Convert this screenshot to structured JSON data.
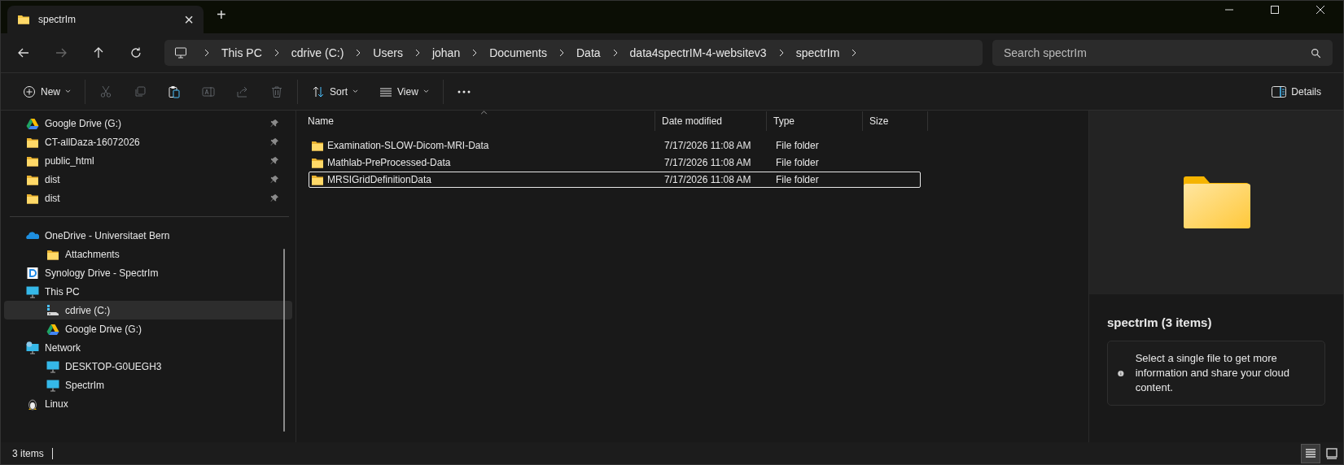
{
  "tab": {
    "title": "spectrIm",
    "close": "×",
    "new_tab": "+"
  },
  "breadcrumb": [
    "This PC",
    "cdrive (C:)",
    "Users",
    "johan",
    "Documents",
    "Data",
    "data4spectrIM-4-websitev3",
    "spectrIm"
  ],
  "search": {
    "placeholder": "Search spectrIm"
  },
  "toolbar": [
    {
      "kind": "new",
      "label": "New"
    },
    {
      "kind": "cut",
      "disabled": true
    },
    {
      "kind": "copy",
      "disabled": true
    },
    {
      "kind": "paste",
      "disabled": false
    },
    {
      "kind": "rename",
      "disabled": true
    },
    {
      "kind": "share",
      "disabled": true
    },
    {
      "kind": "delete",
      "disabled": true
    },
    {
      "kind": "sort",
      "label": "Sort"
    },
    {
      "kind": "view",
      "label": "View"
    },
    {
      "kind": "more"
    }
  ],
  "details_button": {
    "label": "Details"
  },
  "quick_access": [
    {
      "kind": "gdrive",
      "label": "Google Drive (G:)",
      "pinned": true
    },
    {
      "kind": "folder",
      "label": "CT-allDaza-16072026",
      "pinned": true
    },
    {
      "kind": "folder",
      "label": "public_html",
      "pinned": true
    },
    {
      "kind": "folder",
      "label": "dist",
      "pinned": true
    },
    {
      "kind": "folder",
      "label": "dist",
      "pinned": true
    }
  ],
  "tree": [
    {
      "kind": "onedrive",
      "label": "OneDrive - Universitaet Bern",
      "selected": false,
      "children": [
        {
          "kind": "folder",
          "label": "Attachments",
          "selected": false
        }
      ]
    },
    {
      "kind": "synology",
      "label": "Synology Drive - SpectrIm",
      "selected": false
    },
    {
      "kind": "pc",
      "label": "This PC",
      "selected": false,
      "children": [
        {
          "kind": "drive",
          "label": "cdrive (C:)",
          "selected": true
        },
        {
          "kind": "gdrive",
          "label": "Google Drive (G:)",
          "selected": false
        }
      ]
    },
    {
      "kind": "network",
      "label": "Network",
      "selected": false,
      "children": [
        {
          "kind": "monitor",
          "label": "DESKTOP-G0UEGH3",
          "selected": false
        },
        {
          "kind": "monitor",
          "label": "SpectrIm",
          "selected": false
        }
      ]
    },
    {
      "kind": "linux",
      "label": "Linux",
      "selected": false
    }
  ],
  "table": {
    "columns": [
      "Name",
      "Date modified",
      "Type",
      "Size"
    ],
    "rows": [
      {
        "name": "Examination-SLOW-Dicom-MRI-Data",
        "date": "7/17/2026 11:08 AM",
        "type": "File folder",
        "selected": false
      },
      {
        "name": "Mathlab-PreProcessed-Data",
        "date": "7/17/2026 11:08 AM",
        "type": "File folder",
        "selected": false
      },
      {
        "name": "MRSIGridDefinitionData",
        "date": "7/17/2026 11:08 AM",
        "type": "File folder",
        "selected": true
      }
    ]
  },
  "details_pane": {
    "title": "spectrIm (3 items)",
    "info": "Select a single file to get more information and share your cloud content."
  },
  "status_bar": {
    "count": "3 items",
    "views": [
      {
        "kind": "details",
        "selected": true
      },
      {
        "kind": "tiles",
        "selected": false
      }
    ]
  }
}
